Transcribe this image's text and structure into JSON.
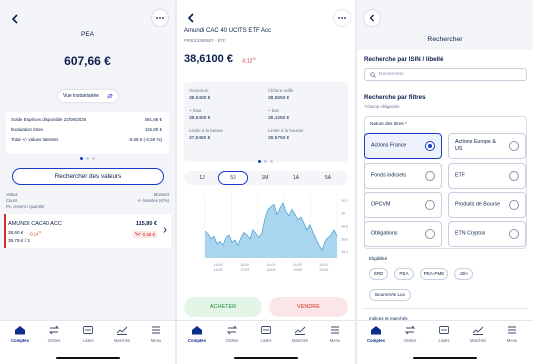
{
  "screen1": {
    "account_title": "PEA",
    "total_value": "607,66 €",
    "view_toggle_label": "Vue instantanée",
    "summary_rows": [
      {
        "label": "Solde Espèces disponible 22/09/2025",
        "value": "491,86 €"
      },
      {
        "label": "Évaluation titres",
        "value": "115,80 €"
      },
      {
        "label": "Total +/- values latentes",
        "value": "-0,58 € (-0,50 %)"
      }
    ],
    "search_button_label": "Rechercher des valeurs",
    "list_header_left": [
      "Valeur",
      "Cours",
      "Px. revient / quantité"
    ],
    "list_header_right": [
      "Montant",
      "+/- latentes (€/%)"
    ],
    "position": {
      "name": "AMUNDI CAC40 ACC",
      "amount": "115,80 €",
      "price": "38,60 €",
      "price_change": "-0,14",
      "change_unit": "%",
      "cost_qty": "38,79 € / 3",
      "latent": "-0,58 €"
    }
  },
  "screen2": {
    "instrument_name": "Amundi CAC 40 UCITS ETF Acc",
    "instrument_code": "FR0013380607 - ETF",
    "price": "38,6100 €",
    "price_change": "-0,12",
    "change_unit": "%",
    "stats": [
      {
        "label": "Ouverture",
        "value": "38,6400 €"
      },
      {
        "label": "Clôture veille",
        "value": "38,6550 €"
      },
      {
        "label": "+ haut",
        "value": "38,6400 €"
      },
      {
        "label": "+ bas",
        "value": "38,4250 €"
      },
      {
        "label": "Limite à la baisse",
        "value": "37,6450 €"
      },
      {
        "label": "Limite à la hausse",
        "value": "39,5750 €"
      }
    ],
    "ranges": [
      "1J",
      "5J",
      "1M",
      "1A",
      "5A"
    ],
    "selected_range": "5J",
    "chart_x_ticks": [
      "16:00",
      "16:00",
      "16:00",
      "16:00",
      "16:00"
    ],
    "chart_x_ticks_sub": [
      "16/09",
      "17/09",
      "18/09",
      "19/09",
      "22/09"
    ],
    "chart_y_ticks": [
      "39.2",
      "39",
      "38.8",
      "38.6",
      "38.4"
    ],
    "buy_label": "ACHETER",
    "sell_label": "VENDRE"
  },
  "chart_data": {
    "type": "area",
    "x_labels": [
      "16/09 16:00",
      "17/09 16:00",
      "18/09 16:00",
      "19/09 16:00",
      "22/09 16:00"
    ],
    "ylim": [
      38.3,
      39.3
    ],
    "values": [
      38.72,
      38.68,
      38.6,
      38.64,
      38.52,
      38.56,
      38.5,
      38.62,
      38.66,
      38.54,
      38.58,
      38.5,
      38.62,
      38.7,
      38.66,
      38.6,
      38.74,
      38.68,
      38.62,
      38.7,
      38.92,
      39.06,
      39.1,
      39.14,
      38.98,
      39.08,
      39.16,
      39.02,
      38.96,
      39.06,
      38.98,
      38.9,
      38.94,
      38.84,
      38.74,
      38.82,
      38.7,
      38.6,
      38.5,
      38.42,
      38.56,
      38.62,
      38.66,
      38.74,
      38.64
    ]
  },
  "screen3": {
    "title": "Rechercher",
    "isin_heading": "Recherche par ISIN / libellé",
    "search_placeholder": "Rechercher",
    "filters_heading": "Recherche par filtres",
    "required_note": "*Champ obligatoire",
    "nature_label": "Nature des titres *",
    "options": [
      {
        "label": "Actions France",
        "selected": true
      },
      {
        "label": "Actions Europe & US",
        "selected": false
      },
      {
        "label": "Fonds indiciels",
        "selected": false
      },
      {
        "label": "ETF",
        "selected": false
      },
      {
        "label": "OPCVM",
        "selected": false
      },
      {
        "label": "Produits de Bourse",
        "selected": false
      },
      {
        "label": "Obligations",
        "selected": false
      },
      {
        "label": "ETN Cryptos",
        "selected": false
      }
    ],
    "eligibility_label": "Éligibilité",
    "eligibility_chips": [
      "SRD",
      "PEA",
      "PEA-PME",
      "J2H",
      "BoursoVie Lux"
    ],
    "indices_label": "Indices et marchés"
  },
  "tabbar": {
    "items": [
      "Comptes",
      "Ordres",
      "Listes",
      "Marchés",
      "Menu"
    ]
  },
  "colors": {
    "accent": "#1a3cc8",
    "negative": "#d0312d",
    "buy_bg": "#e3f5e7",
    "sell_bg": "#fbe6e7",
    "chart_fill": "#a9d6ee"
  }
}
